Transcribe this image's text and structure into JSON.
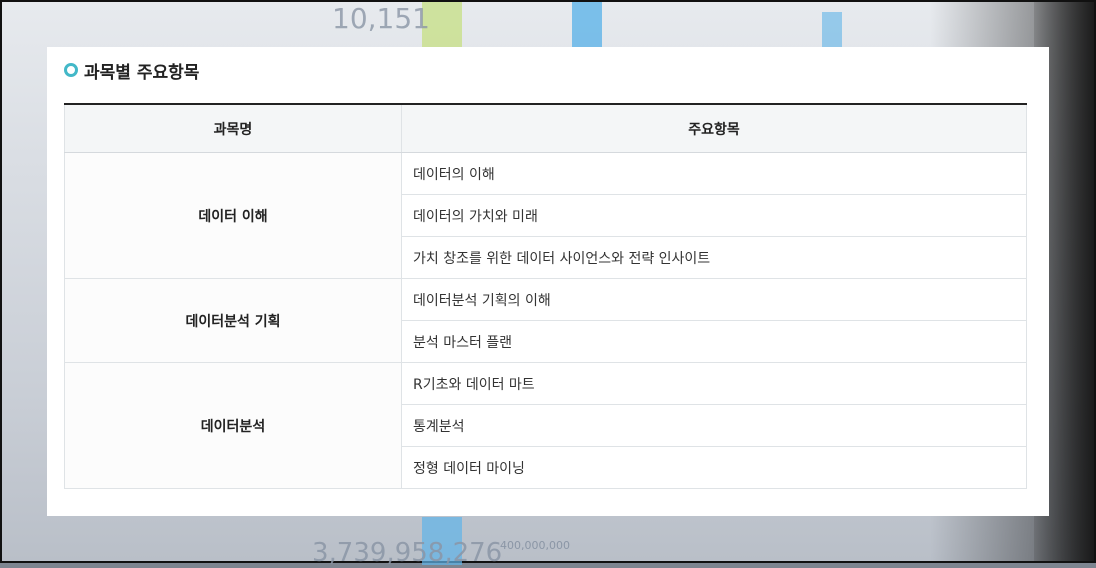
{
  "section": {
    "title": "과목별 주요항목"
  },
  "table": {
    "headers": [
      "과목명",
      "주요항목"
    ],
    "groups": [
      {
        "subject": "데이터 이해",
        "items": [
          "데이터의 이해",
          "데이터의 가치와 미래",
          "가치 창조를 위한 데이터 사이언스와 전략 인사이트"
        ]
      },
      {
        "subject": "데이터분석 기획",
        "items": [
          "데이터분석 기획의 이해",
          "분석 마스터 플랜"
        ]
      },
      {
        "subject": "데이터분석",
        "items": [
          "R기초와 데이터 마트",
          "통계분석",
          "정형 데이터 마이닝"
        ]
      }
    ]
  },
  "background": {
    "top_number": "10,151",
    "bottom_number": "3,739,958,276",
    "bottom_small": "400,000,000"
  },
  "colors": {
    "accent": "#43b8c8",
    "header_bg": "#f4f6f7",
    "border": "#dfe3e6"
  },
  "icons": {
    "heading_bullet": "ring-bullet-icon"
  }
}
